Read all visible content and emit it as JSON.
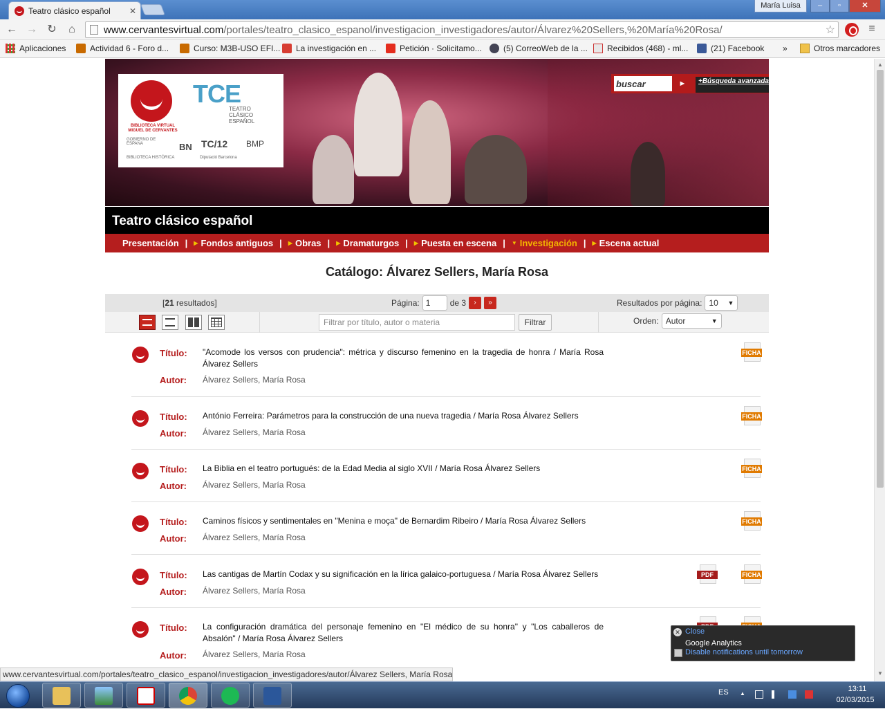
{
  "browser": {
    "tab_title": "Teatro clásico español",
    "tab_close": "✕",
    "user": "María Luisa",
    "window_min": "–",
    "window_max": "▫",
    "window_close": "✕",
    "nav": {
      "back": "←",
      "forward": "→",
      "reload": "↻",
      "home": "⌂"
    },
    "url_host": "www.cervantesvirtual.com",
    "url_path": "/portales/teatro_clasico_espanol/investigacion_investigadores/autor/Álvarez%20Sellers,%20María%20Rosa/",
    "star": "☆",
    "menu": "≡",
    "bookmarks": [
      {
        "label": "Aplicaciones",
        "icon": "apps-grid-icon"
      },
      {
        "label": "Actividad 6 - Foro d...",
        "icon": "moodle-icon"
      },
      {
        "label": "Curso: M3B-USO EFI...",
        "icon": "moodle-icon"
      },
      {
        "label": "La investigación en ...",
        "icon": "google-plus-icon"
      },
      {
        "label": "Petición · Solicitamo...",
        "icon": "change-org-icon"
      },
      {
        "label": "(5) CorreoWeb de la ...",
        "icon": "mail-icon"
      },
      {
        "label": "Recibidos (468) - ml...",
        "icon": "gmail-icon"
      },
      {
        "label": "(21) Facebook",
        "icon": "facebook-icon"
      }
    ],
    "bookmarks_more": "»",
    "other_bookmarks": "Otros marcadores",
    "status_url": "www.cervantesvirtual.com/portales/teatro_clasico_espanol/investigacion_investigadores/autor/Álvarez Sellers, María Rosa/"
  },
  "site": {
    "search_placeholder": "buscar",
    "search_go": "►",
    "advanced_search": "+Búsqueda avanzada",
    "logo": {
      "bvmc": "BIBLIOTECA VIRTUAL MIGUEL DE CERVANTES",
      "tce": "TCE",
      "tce_sub": "TEATRO CLÁSICO ESPAÑOL",
      "partners": [
        "GOBIERNO DE ESPAÑA",
        "BN",
        "TC/12",
        "BMP",
        "BIBLIOTECA HISTÓRICA",
        "Diputació Barcelona"
      ]
    },
    "title": "Teatro clásico español",
    "nav": [
      {
        "label": "Presentación",
        "arrow": false,
        "active": false
      },
      {
        "label": "Fondos antiguos",
        "arrow": true,
        "active": false
      },
      {
        "label": "Obras",
        "arrow": true,
        "active": false
      },
      {
        "label": "Dramaturgos",
        "arrow": true,
        "active": false
      },
      {
        "label": "Puesta en escena",
        "arrow": true,
        "active": false
      },
      {
        "label": "Investigación",
        "arrow": true,
        "active": true
      },
      {
        "label": "Escena actual",
        "arrow": true,
        "active": false
      }
    ],
    "nav_sep": "|"
  },
  "catalog": {
    "heading": "Catálogo: Álvarez Sellers, María Rosa",
    "results_open": "[",
    "results_count": "21",
    "results_word": " resultados]",
    "page_label": "Página:",
    "page_value": "1",
    "page_of": "de 3",
    "next": "›",
    "last": "»",
    "per_page_label": "Resultados por página:",
    "per_page_value": "10",
    "filter_placeholder": "Filtrar por título, autor o materia",
    "filter_button": "Filtrar",
    "order_label": "Orden:",
    "order_value": "Autor",
    "labels": {
      "title": "Título:",
      "author": "Autor:"
    },
    "badges": {
      "ficha": "FICHA",
      "pdf": "PDF"
    },
    "results": [
      {
        "title": "\"Acomode los versos con prudencia\": métrica y discurso femenino en la tragedia de honra / María Rosa Álvarez Sellers",
        "author": "Álvarez Sellers, María Rosa",
        "pdf": false
      },
      {
        "title": "António Ferreira: Parámetros para la construcción de una nueva tragedia / María Rosa Álvarez Sellers",
        "author": "Álvarez Sellers, María Rosa",
        "pdf": false
      },
      {
        "title": "La Biblia en el teatro portugués: de la Edad Media al siglo XVII / María Rosa Álvarez Sellers",
        "author": "Álvarez Sellers, María Rosa",
        "pdf": false
      },
      {
        "title": "Caminos físicos y sentimentales en \"Menina e moça\" de Bernardim Ribeiro / María Rosa Álvarez Sellers",
        "author": "Álvarez Sellers, María Rosa",
        "pdf": false
      },
      {
        "title": "Las cantigas de Martín Codax y su significación en la lírica galaico-portuguesa / María Rosa Álvarez Sellers",
        "author": "Álvarez Sellers, María Rosa",
        "pdf": true
      },
      {
        "title": "La configuración dramática del personaje femenino en \"El médico de su honra\" y \"Los caballeros de Absalón\" / María Rosa Álvarez Sellers",
        "author": "Álvarez Sellers, María Rosa",
        "pdf": true
      }
    ]
  },
  "notification": {
    "close": "Close",
    "title": "Google Analytics",
    "disable": "Disable notifications until tomorrow",
    "x": "✕"
  },
  "taskbar": {
    "lang": "ES",
    "time": "13:11",
    "date": "02/03/2015",
    "apps": [
      "explorer-icon",
      "picture-viewer-icon",
      "acrobat-icon",
      "chrome-icon",
      "spotify-icon",
      "word-icon"
    ]
  }
}
